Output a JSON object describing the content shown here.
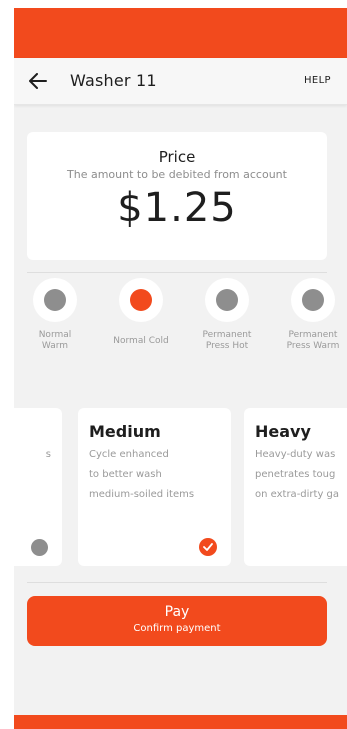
{
  "header": {
    "title": "Washer 11",
    "help_label": "HELP",
    "back_icon": "arrow-left-icon"
  },
  "price": {
    "title": "Price",
    "subtitle": "The amount to be debited from account",
    "amount": "$1.25"
  },
  "temperatures": [
    {
      "label": "Normal\nWarm",
      "selected": false
    },
    {
      "label": "Normal Cold",
      "selected": true
    },
    {
      "label": "Permanent\nPress Hot",
      "selected": false
    },
    {
      "label": "Permanent\nPress Warm",
      "selected": false
    }
  ],
  "cycles": [
    {
      "name": "",
      "desc_lines": [
        "",
        "s",
        ""
      ],
      "selected": false
    },
    {
      "name": "Medium",
      "desc_lines": [
        "Cycle enhanced",
        "to better wash",
        "medium-soiled items"
      ],
      "selected": true
    },
    {
      "name": "Heavy",
      "desc_lines": [
        "Heavy-duty was",
        "penetrates toug",
        "on extra-dirty ga"
      ],
      "selected": false
    }
  ],
  "pay": {
    "label": "Pay",
    "sublabel": "Confirm payment"
  },
  "colors": {
    "accent": "#f24a1d",
    "inactive": "#8e8e8e"
  }
}
